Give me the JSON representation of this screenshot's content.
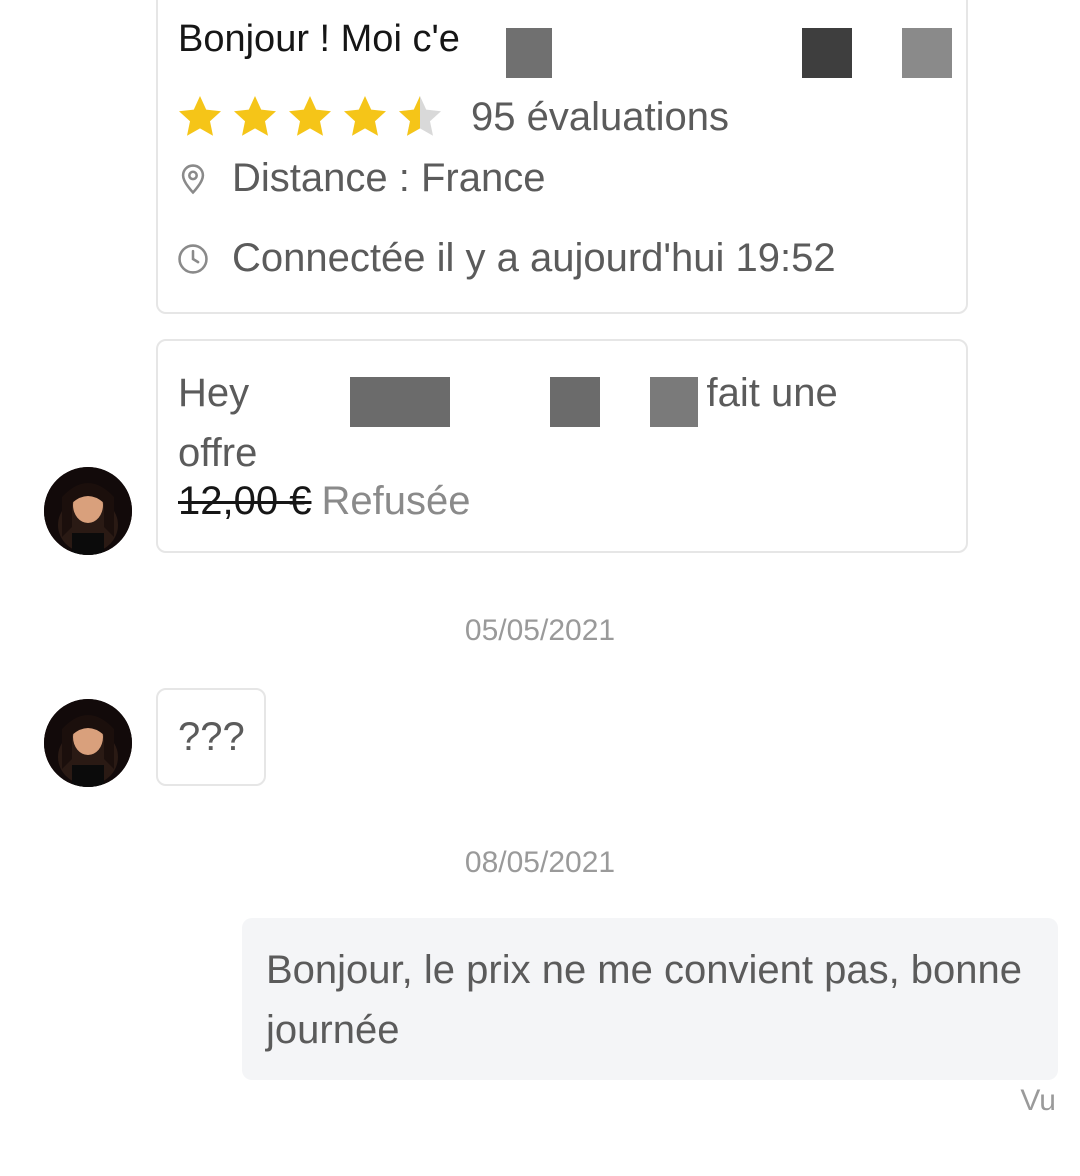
{
  "profile_card": {
    "greeting": "Bonjour ! Moi c'e",
    "rating": 4.5,
    "rating_max": 5,
    "reviews": "95 évaluations",
    "distance": "Distance : France",
    "last_seen": "Connectée il y a aujourd'hui 19:52",
    "star_color": "#f5c518",
    "star_empty_color": "#d9d9d9"
  },
  "offer_card": {
    "text_start": "Hey",
    "text_end": "a fait une",
    "text_line2": "offre",
    "price": "12,00 €",
    "status": "Refusée"
  },
  "messages": {
    "date1": "05/05/2021",
    "incoming_text": "???",
    "date2": "08/05/2021",
    "outgoing_text": "Bonjour, le prix ne me convient pas, bonne journée",
    "outgoing_status": "Vu"
  },
  "icons": {
    "location": "location-pin-icon",
    "clock": "clock-icon",
    "star": "star-icon"
  }
}
